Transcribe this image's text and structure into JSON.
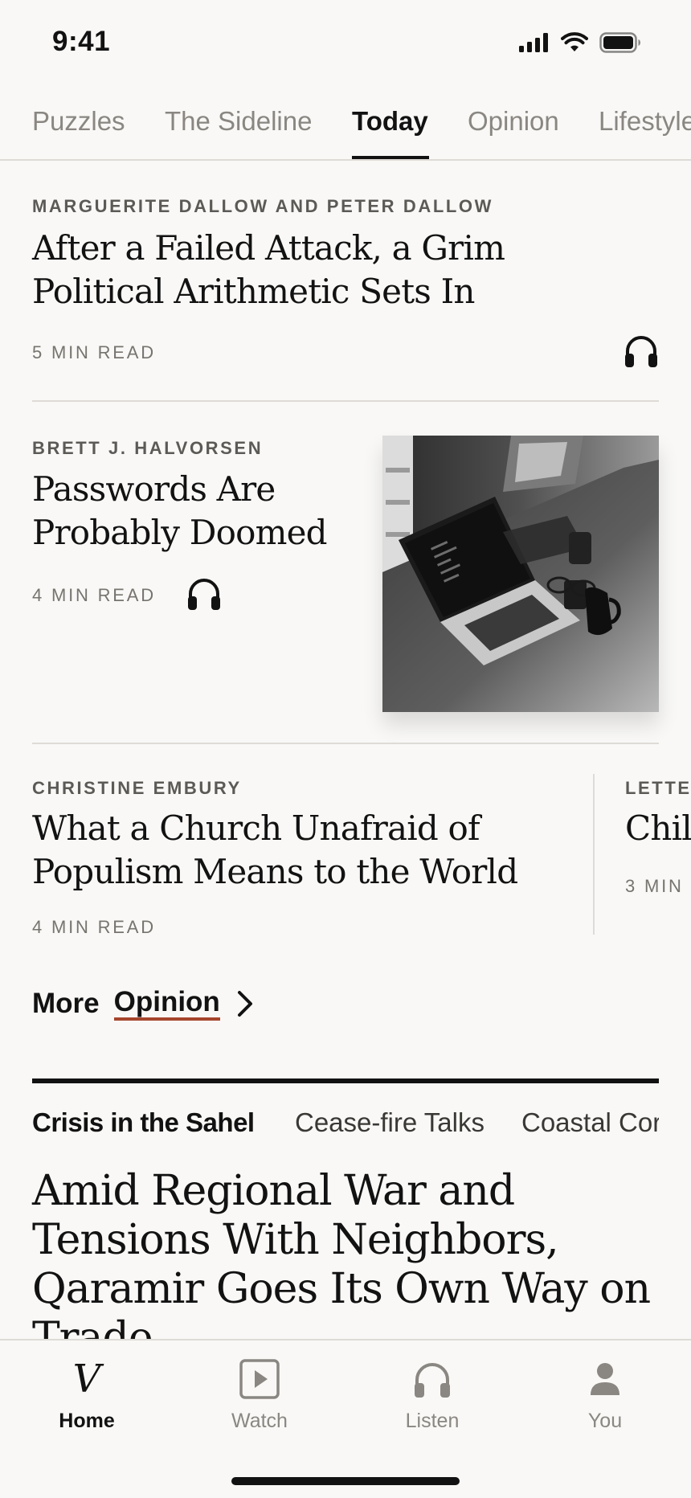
{
  "status_bar": {
    "time": "9:41"
  },
  "section_tabs": [
    {
      "label": "Puzzles",
      "active": false
    },
    {
      "label": "The Sideline",
      "active": false
    },
    {
      "label": "Today",
      "active": true
    },
    {
      "label": "Opinion",
      "active": false
    },
    {
      "label": "Lifestyle",
      "active": false
    }
  ],
  "stories": [
    {
      "byline": "MARGUERITE DALLOW AND PETER DALLOW",
      "headline": "After a Failed Attack, a Grim Political Arithmetic Sets In",
      "read_time": "5 MIN READ",
      "audio": true
    },
    {
      "byline": "BRETT J. HALVORSEN",
      "headline": "Passwords Are Probably Doomed",
      "read_time": "4 MIN READ",
      "audio": true,
      "image": "laptop-on-desk-photo"
    },
    {
      "byline": "CHRISTINE EMBURY",
      "headline": "What a Church Unafraid of Populism Means to the World",
      "read_time": "4 MIN READ"
    },
    {
      "byline": "LETTE",
      "headline": "Chil",
      "read_time": "3 MIN"
    }
  ],
  "more_section": {
    "prefix": "More",
    "link": "Opinion"
  },
  "topics": [
    {
      "label": "Crisis in the Sahel",
      "active": true
    },
    {
      "label": "Cease-fire Talks",
      "active": false
    },
    {
      "label": "Coastal Cor",
      "active": false
    }
  ],
  "lead_headline": "Amid Regional War and Tensions With Neighbors, Qaramir Goes Its Own Way on Trade",
  "tab_bar": [
    {
      "label": "Home",
      "icon": "logo-v",
      "glyph": "V",
      "active": true
    },
    {
      "label": "Watch",
      "icon": "play-icon",
      "active": false
    },
    {
      "label": "Listen",
      "icon": "headphones-icon",
      "active": false
    },
    {
      "label": "You",
      "icon": "person-icon",
      "active": false
    }
  ],
  "colors": {
    "background": "#f9f8f6",
    "text": "#121212",
    "accent_underline": "#a5452c",
    "muted": "#8a8782"
  }
}
